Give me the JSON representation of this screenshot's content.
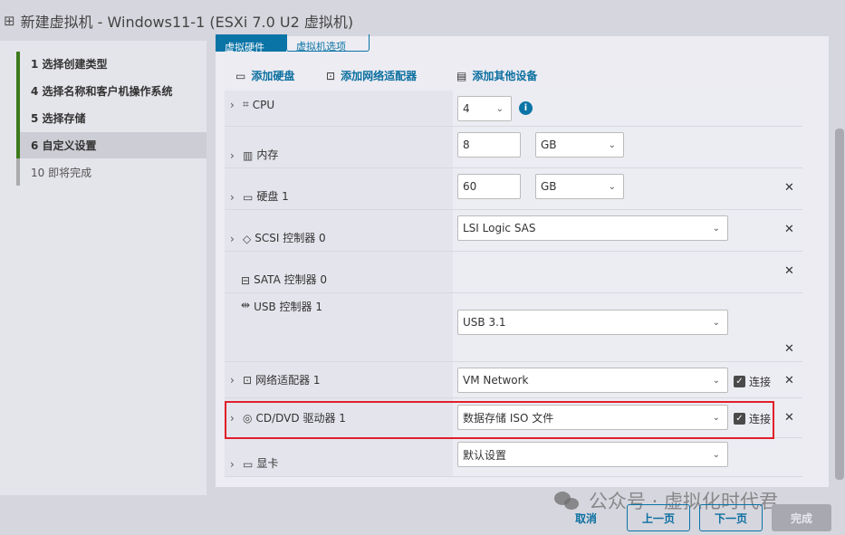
{
  "window": {
    "title": "新建虚拟机 - Windows11-1 (ESXi 7.0 U2 虚拟机)",
    "icon": "new-vm-icon"
  },
  "steps": [
    {
      "label": "1  选择创建类型"
    },
    {
      "label": "4  选择名称和客户机操作系统"
    },
    {
      "label": "5  选择存储"
    },
    {
      "label": "6  自定义设置",
      "selected": true
    },
    {
      "label": "10  即将完成"
    }
  ],
  "tabs": [
    {
      "label": "虚拟硬件",
      "active": true
    },
    {
      "label": "虚拟机选项"
    }
  ],
  "toolbar": {
    "add_disk": "添加硬盘",
    "add_nic": "添加网络适配器",
    "add_other": "添加其他设备"
  },
  "hardware": {
    "cpu": {
      "label": "CPU",
      "value": "4"
    },
    "memory": {
      "label": "内存",
      "value": "8",
      "unit": "GB"
    },
    "disk": {
      "label": "硬盘 1",
      "value": "60",
      "unit": "GB"
    },
    "scsi": {
      "label": "SCSI 控制器 0",
      "value": "LSI Logic SAS"
    },
    "sata": {
      "label": "SATA 控制器 0"
    },
    "usb": {
      "label": "USB 控制器 1",
      "value": "USB 3.1"
    },
    "network": {
      "label": "网络适配器 1",
      "value": "VM Network",
      "connect": "连接"
    },
    "cdrom": {
      "label": "CD/DVD 驱动器 1",
      "value": "数据存储 ISO 文件",
      "connect": "连接"
    },
    "video": {
      "label": "显卡",
      "value": "默认设置"
    }
  },
  "footer": {
    "cancel": "取消",
    "back": "上一页",
    "next": "下一页",
    "finish": "完成"
  },
  "watermark": "公众号 · 虚拟化时代君",
  "colors": {
    "accent": "#0b74a6",
    "progress": "#3c7a1c",
    "highlight": "#e0202a"
  }
}
